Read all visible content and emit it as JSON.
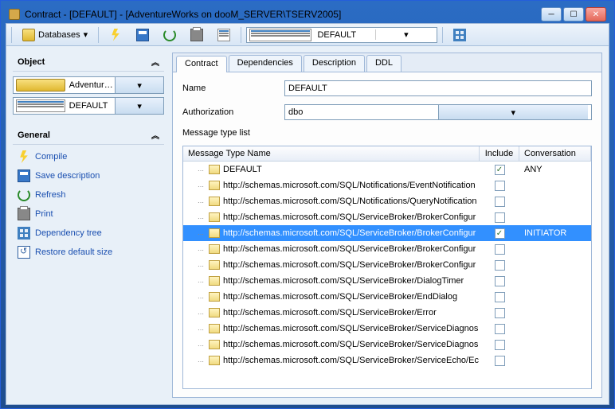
{
  "window": {
    "title": "Contract - [DEFAULT] - [AdventureWorks on dooM_SERVER\\TSERV2005]"
  },
  "toolbar": {
    "databases_label": "Databases",
    "combo_value": "DEFAULT"
  },
  "sidebar": {
    "object_label": "Object",
    "object_db": "AdventureWorks on dooM",
    "object_item": "DEFAULT",
    "general_label": "General",
    "actions": [
      {
        "label": "Compile"
      },
      {
        "label": "Save description"
      },
      {
        "label": "Refresh"
      },
      {
        "label": "Print"
      },
      {
        "label": "Dependency tree"
      },
      {
        "label": "Restore default size"
      }
    ]
  },
  "tabs": {
    "items": [
      {
        "label": "Contract"
      },
      {
        "label": "Dependencies"
      },
      {
        "label": "Description"
      },
      {
        "label": "DDL"
      }
    ]
  },
  "form": {
    "name_label": "Name",
    "name_value": "DEFAULT",
    "auth_label": "Authorization",
    "auth_value": "dbo",
    "list_label": "Message type list"
  },
  "list": {
    "headers": {
      "name": "Message Type Name",
      "include": "Include",
      "conversation": "Conversation"
    },
    "rows": [
      {
        "name": "DEFAULT",
        "include": true,
        "conversation": "ANY",
        "selected": false
      },
      {
        "name": "http://schemas.microsoft.com/SQL/Notifications/EventNotification",
        "include": false,
        "conversation": "",
        "selected": false
      },
      {
        "name": "http://schemas.microsoft.com/SQL/Notifications/QueryNotification",
        "include": false,
        "conversation": "",
        "selected": false
      },
      {
        "name": "http://schemas.microsoft.com/SQL/ServiceBroker/BrokerConfigur",
        "include": false,
        "conversation": "",
        "selected": false
      },
      {
        "name": "http://schemas.microsoft.com/SQL/ServiceBroker/BrokerConfigur",
        "include": true,
        "conversation": "INITIATOR",
        "selected": true
      },
      {
        "name": "http://schemas.microsoft.com/SQL/ServiceBroker/BrokerConfigur",
        "include": false,
        "conversation": "",
        "selected": false
      },
      {
        "name": "http://schemas.microsoft.com/SQL/ServiceBroker/BrokerConfigur",
        "include": false,
        "conversation": "",
        "selected": false
      },
      {
        "name": "http://schemas.microsoft.com/SQL/ServiceBroker/DialogTimer",
        "include": false,
        "conversation": "",
        "selected": false
      },
      {
        "name": "http://schemas.microsoft.com/SQL/ServiceBroker/EndDialog",
        "include": false,
        "conversation": "",
        "selected": false
      },
      {
        "name": "http://schemas.microsoft.com/SQL/ServiceBroker/Error",
        "include": false,
        "conversation": "",
        "selected": false
      },
      {
        "name": "http://schemas.microsoft.com/SQL/ServiceBroker/ServiceDiagnos",
        "include": false,
        "conversation": "",
        "selected": false
      },
      {
        "name": "http://schemas.microsoft.com/SQL/ServiceBroker/ServiceDiagnos",
        "include": false,
        "conversation": "",
        "selected": false
      },
      {
        "name": "http://schemas.microsoft.com/SQL/ServiceBroker/ServiceEcho/Ec",
        "include": false,
        "conversation": "",
        "selected": false
      }
    ]
  }
}
